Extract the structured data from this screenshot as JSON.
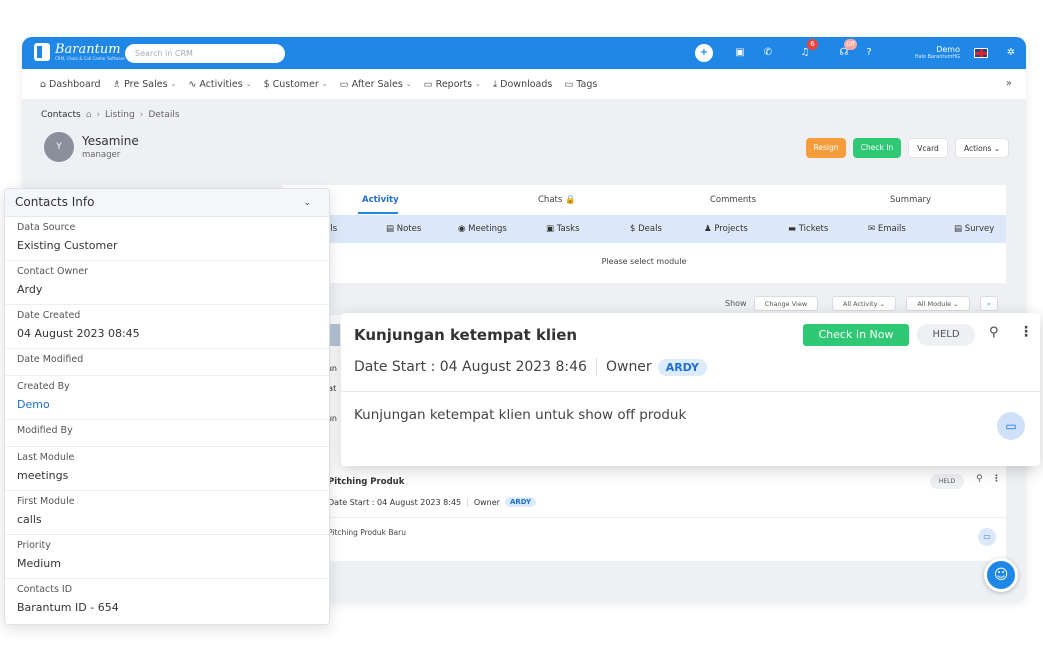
{
  "header": {
    "brand": "Barantum",
    "brand_tagline": "CRM, Chats & Call Center Software",
    "search_placeholder": "Search in CRM",
    "notification_count": "6",
    "status_badge": "Off",
    "user_name": "Demo",
    "user_sub": "Halo BarantumHG"
  },
  "nav": {
    "items": [
      {
        "label": "Dashboard",
        "icon": "home-icon"
      },
      {
        "label": "Pre Sales",
        "icon": "users-icon"
      },
      {
        "label": "Activities",
        "icon": "activity-icon"
      },
      {
        "label": "Customer",
        "icon": "dollar-icon"
      },
      {
        "label": "After Sales",
        "icon": "box-icon"
      },
      {
        "label": "Reports",
        "icon": "folder-icon"
      },
      {
        "label": "Downloads",
        "icon": "download-icon"
      },
      {
        "label": "Tags",
        "icon": "tag-icon"
      }
    ],
    "more": "»"
  },
  "breadcrumb": {
    "root": "Contacts",
    "listing": "Listing",
    "current": "Details"
  },
  "profile": {
    "initial": "Y",
    "name": "Yesamine",
    "role": "manager"
  },
  "buttons": {
    "resign": "Resign",
    "checkin": "Check In",
    "vcard": "Vcard",
    "actions": "Actions ⌄"
  },
  "tabs": [
    "Activity",
    "Chats 🔒",
    "Comments",
    "Summary"
  ],
  "modules": [
    "lls",
    "Notes",
    "Meetings",
    "Tasks",
    "Deals",
    "Projects",
    "Tickets",
    "Emails",
    "Survey"
  ],
  "select_message": "Please select module",
  "filters": {
    "show": "Show",
    "change_view": "Change View",
    "all_activity": "All Activity ⌄",
    "all_module": "All Module ⌄"
  },
  "contacts_info": {
    "title": "Contacts Info",
    "rows": [
      {
        "label": "Data Source",
        "value": "Existing Customer"
      },
      {
        "label": "Contact Owner",
        "value": "Ardy"
      },
      {
        "label": "Date Created",
        "value": "04 August 2023 08:45"
      },
      {
        "label": "Date Modified",
        "value": ""
      },
      {
        "label": "Created By",
        "value": "Demo"
      },
      {
        "label": "Modified By",
        "value": ""
      },
      {
        "label": "Last Module",
        "value": "meetings"
      },
      {
        "label": "First Module",
        "value": "calls"
      },
      {
        "label": "Priority",
        "value": "Medium"
      },
      {
        "label": "Contacts ID",
        "value": "Barantum ID - 654"
      }
    ]
  },
  "activity_popup": {
    "title": "Kunjungan ketempat klien",
    "checkin_now": "Check In Now",
    "status": "HELD",
    "date_start": "Date Start : 04 August 2023 8:46",
    "owner_label": "Owner",
    "owner": "ARDY",
    "description": "Kunjungan ketempat klien untuk show off produk"
  },
  "activity_2": {
    "title": "Pitching Produk",
    "status": "HELD",
    "date_start": "Date Start : 04 August 2023 8:45",
    "owner_label": "Owner",
    "owner": "ARDY",
    "description": "Pitching Produk Baru"
  },
  "ghost_labels": {
    "kun": "Kun",
    "dat": "Dat",
    "kun2": "Kun"
  }
}
